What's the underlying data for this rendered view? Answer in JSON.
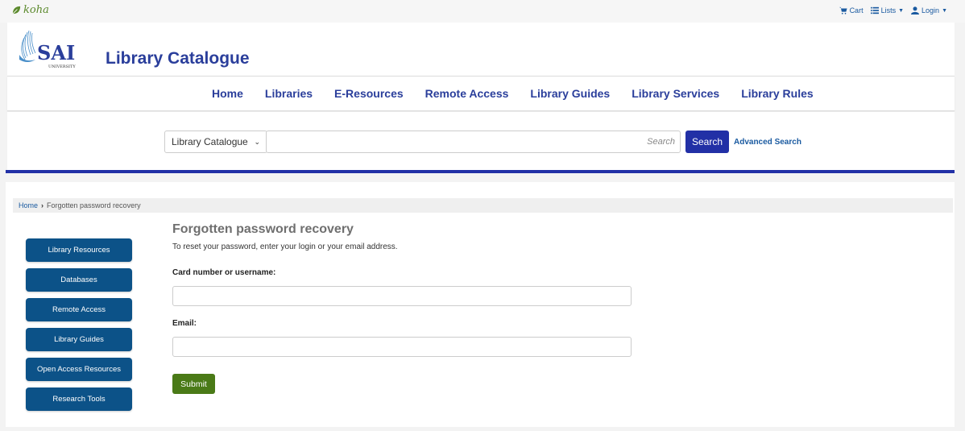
{
  "topbar": {
    "brand": "koha",
    "links": [
      {
        "label": "Cart",
        "icon": "cart-icon"
      },
      {
        "label": "Lists",
        "icon": "list-icon"
      },
      {
        "label": "Login",
        "icon": "user-icon"
      }
    ]
  },
  "header": {
    "logo_text": "SAI",
    "logo_subtext": "UNIVERSITY",
    "title": "Library Catalogue"
  },
  "nav": {
    "items": [
      "Home",
      "Libraries",
      "E-Resources",
      "Remote Access",
      "Library Guides",
      "Library Services",
      "Library Rules"
    ]
  },
  "search": {
    "scope": "Library Catalogue",
    "placeholder": "Search",
    "button": "Search",
    "advanced": "Advanced Search"
  },
  "breadcrumb": {
    "home": "Home",
    "current": "Forgotten password recovery"
  },
  "sidebar": {
    "buttons": [
      "Library Resources",
      "Databases",
      "Remote Access",
      "Library Guides",
      "Open Access Resources",
      "Research Tools"
    ]
  },
  "form": {
    "title": "Forgotten password recovery",
    "intro": "To reset your password, enter your login or your email address.",
    "card_label": "Card number or username:",
    "email_label": "Email:",
    "submit": "Submit"
  },
  "colors": {
    "brand_blue": "#2a3e9b",
    "search_button": "#2230a6",
    "sidebar_button": "#0c5288",
    "submit_button": "#4a7a17"
  }
}
